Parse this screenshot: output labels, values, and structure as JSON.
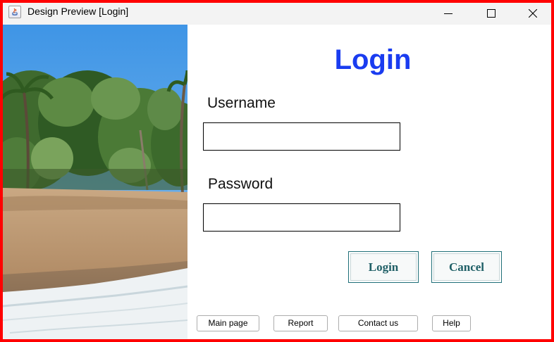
{
  "window": {
    "title": "Design Preview [Login]",
    "controls": [
      "minimize-icon",
      "maximize-icon",
      "close-icon"
    ],
    "border_color": "#ff0000"
  },
  "image": {
    "subject": "beach-photo"
  },
  "form": {
    "title": "Login",
    "title_color": "#1a3cf0",
    "username_label": "Username",
    "username_value": "",
    "password_label": "Password",
    "password_value": "",
    "login_button": "Login",
    "cancel_button": "Cancel"
  },
  "footer": {
    "links": [
      "Main page",
      "Report",
      "Contact us",
      "Help"
    ]
  }
}
